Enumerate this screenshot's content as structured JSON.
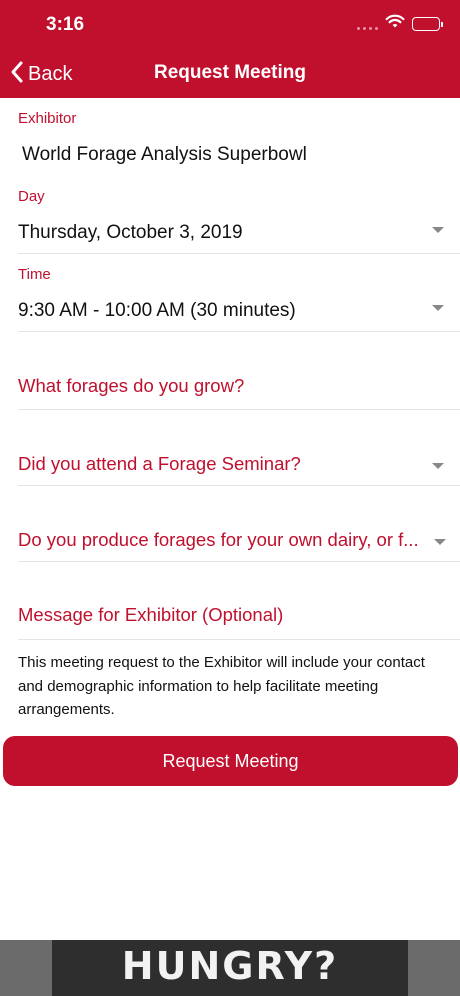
{
  "status_bar": {
    "time": "3:16"
  },
  "nav": {
    "back_label": "Back",
    "title": "Request Meeting"
  },
  "form": {
    "exhibitor_label": "Exhibitor",
    "exhibitor_value": "World Forage Analysis Superbowl",
    "day_label": "Day",
    "day_value": "Thursday, October 3, 2019",
    "time_label": "Time",
    "time_value": "9:30 AM - 10:00 AM (30 minutes)",
    "questions": [
      "What forages do you grow?",
      "Did you attend a Forage Seminar?",
      "Do you produce forages for your own dairy, or f..."
    ],
    "message_placeholder": "Message for Exhibitor (Optional)",
    "disclaimer": "This meeting request to the Exhibitor will include your contact and demographic information to help facilitate meeting arrangements.",
    "submit_label": "Request Meeting"
  },
  "ad": {
    "text": "HUNGRY?"
  },
  "colors": {
    "brand": "#c0102e",
    "divider": "#e4e4e4",
    "caret": "#888888"
  },
  "icons": [
    "wifi-icon",
    "battery-icon",
    "chevron-left-icon",
    "caret-down-icon"
  ]
}
